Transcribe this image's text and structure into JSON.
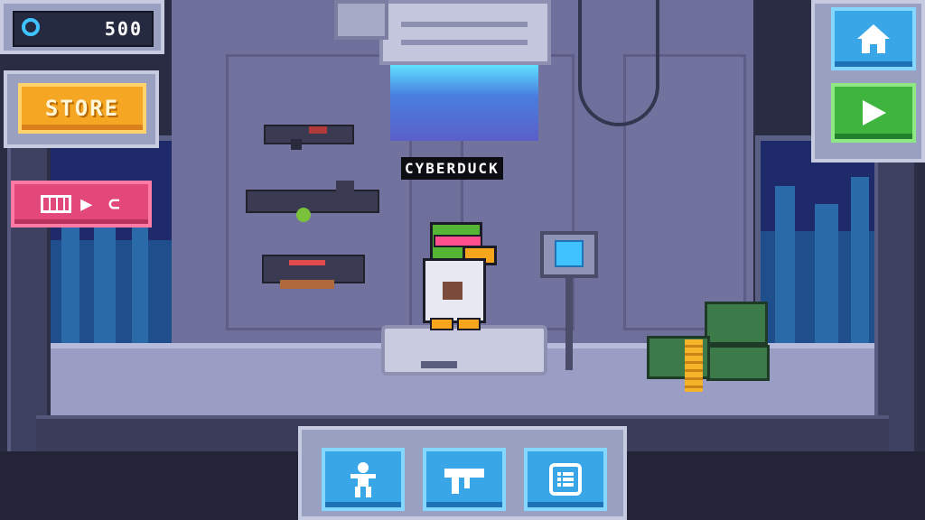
{
  "hud": {
    "currency_value": "500",
    "currency_icon": "cyber-coin-icon",
    "store_label": "STORE",
    "video_reward_label": "▶ ⊂",
    "video_icon": "film-icon"
  },
  "nav": {
    "home_icon": "home-icon",
    "play_icon": "play-icon"
  },
  "character": {
    "name": "CYBERDUCK"
  },
  "toolbar": {
    "buttons": [
      {
        "icon": "character-icon"
      },
      {
        "icon": "weapon-icon"
      },
      {
        "icon": "list-icon"
      }
    ]
  },
  "colors": {
    "store_button": "#f5a623",
    "video_button": "#e2497a",
    "home_button": "#39a6e8",
    "play_button": "#3fb53f",
    "coin_accent": "#3ec3ff"
  }
}
